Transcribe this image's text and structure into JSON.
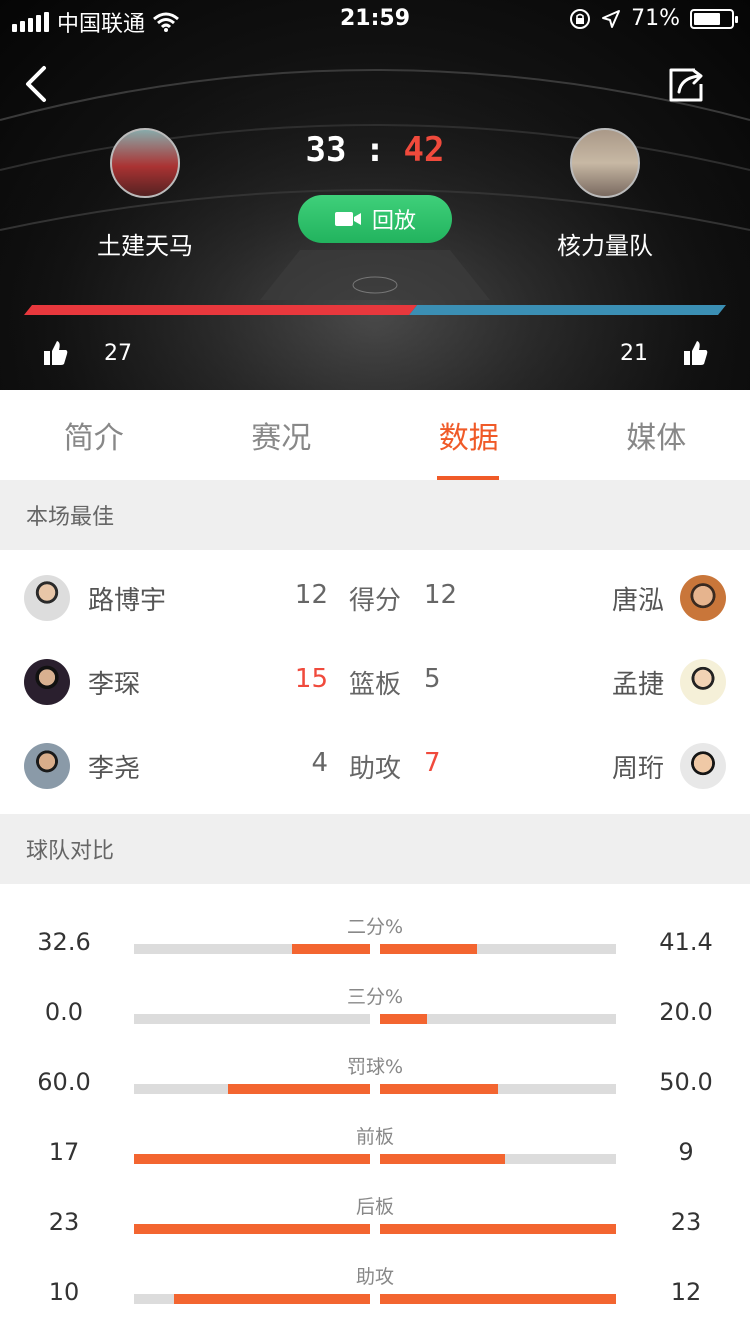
{
  "status_bar": {
    "carrier": "中国联通",
    "time": "21:59",
    "battery": "71%",
    "battery_level": 0.71
  },
  "match": {
    "home_team": "土建天马",
    "away_team": "核力量队",
    "home_score": "33",
    "separator": ":",
    "away_score": "42",
    "replay_label": "回放",
    "home_likes": "27",
    "away_likes": "21",
    "home_like_ratio": 0.56
  },
  "colors": {
    "accent": "#f05a28",
    "score_red": "#f04a3c",
    "home_bar": "#e8383d",
    "away_bar": "#3b8fb4",
    "replay_green": "#2bc06a"
  },
  "tabs": [
    {
      "label": "简介",
      "active": false
    },
    {
      "label": "赛况",
      "active": false
    },
    {
      "label": "数据",
      "active": true
    },
    {
      "label": "媒体",
      "active": false
    }
  ],
  "best": {
    "title": "本场最佳",
    "rows": [
      {
        "left_name": "路博宇",
        "left_value": "12",
        "label": "得分",
        "right_value": "12",
        "right_name": "唐泓",
        "highlight": "none"
      },
      {
        "left_name": "李琛",
        "left_value": "15",
        "label": "篮板",
        "right_value": "5",
        "right_name": "孟捷",
        "highlight": "left"
      },
      {
        "left_name": "李尧",
        "left_value": "4",
        "label": "助攻",
        "right_value": "7",
        "right_name": "周珩",
        "highlight": "right"
      }
    ]
  },
  "compare": {
    "title": "球队对比",
    "rows": [
      {
        "label": "二分%",
        "left": "32.6",
        "right": "41.4",
        "left_ratio": 0.33,
        "right_ratio": 0.41
      },
      {
        "label": "三分%",
        "left": "0.0",
        "right": "20.0",
        "left_ratio": 0.0,
        "right_ratio": 0.2
      },
      {
        "label": "罚球%",
        "left": "60.0",
        "right": "50.0",
        "left_ratio": 0.6,
        "right_ratio": 0.5
      },
      {
        "label": "前板",
        "left": "17",
        "right": "9",
        "left_ratio": 1.0,
        "right_ratio": 0.53
      },
      {
        "label": "后板",
        "left": "23",
        "right": "23",
        "left_ratio": 1.0,
        "right_ratio": 1.0
      },
      {
        "label": "助攻",
        "left": "10",
        "right": "12",
        "left_ratio": 0.83,
        "right_ratio": 1.0
      }
    ]
  }
}
